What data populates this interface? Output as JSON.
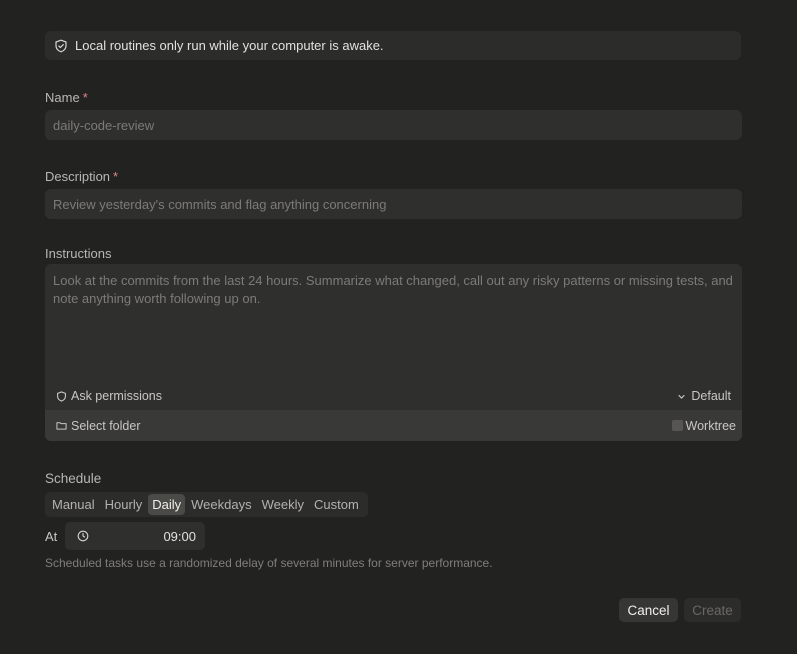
{
  "notice": {
    "text": "Local routines only run while your computer is awake."
  },
  "name": {
    "label": "Name",
    "required": "*",
    "placeholder": "daily-code-review"
  },
  "description": {
    "label": "Description",
    "required": "*",
    "placeholder": "Review yesterday's commits and flag anything concerning"
  },
  "instructions": {
    "label": "Instructions",
    "placeholder": "Look at the commits from the last 24 hours. Summarize what changed, call out any risky patterns or missing tests, and note anything worth following up on.",
    "permissions_label": "Ask permissions",
    "model_label": "Default",
    "folder_label": "Select folder",
    "worktree_label": "Worktree"
  },
  "schedule": {
    "label": "Schedule",
    "options": [
      "Manual",
      "Hourly",
      "Daily",
      "Weekdays",
      "Weekly",
      "Custom"
    ],
    "selected": "Daily",
    "at_label": "At",
    "time": "09:00",
    "hint": "Scheduled tasks use a randomized delay of several minutes for server performance."
  },
  "actions": {
    "cancel": "Cancel",
    "create": "Create"
  }
}
